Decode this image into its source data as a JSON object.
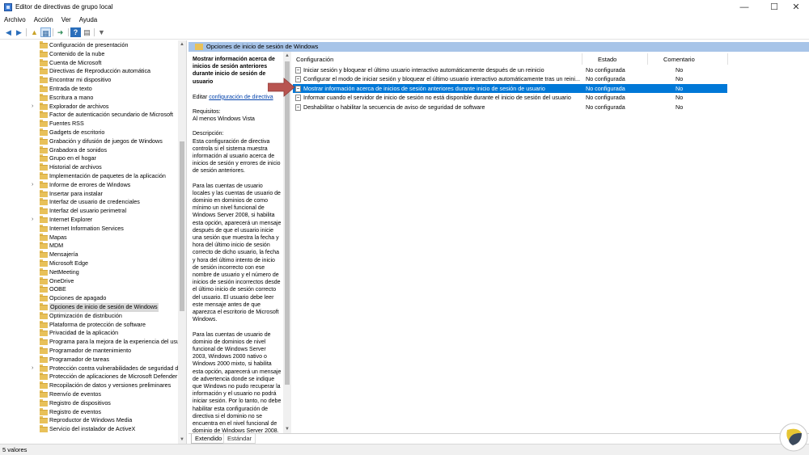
{
  "window": {
    "title": "Editor de directivas de grupo local",
    "minimize": "—",
    "maximize": "☐",
    "close": "✕"
  },
  "menu": [
    "Archivo",
    "Acción",
    "Ver",
    "Ayuda"
  ],
  "toolbar_icons": [
    "back-icon",
    "forward-icon",
    "up-folder-icon",
    "show-tree-icon",
    "export-list-icon",
    "help-icon",
    "properties-icon",
    "filter-icon"
  ],
  "tree": {
    "items": [
      {
        "label": "Configuración de presentación",
        "expandable": false
      },
      {
        "label": "Contenido de la nube",
        "expandable": false
      },
      {
        "label": "Cuenta de Microsoft",
        "expandable": false
      },
      {
        "label": "Directivas de Reproducción automática",
        "expandable": false
      },
      {
        "label": "Encontrar mi dispositivo",
        "expandable": false
      },
      {
        "label": "Entrada de texto",
        "expandable": false
      },
      {
        "label": "Escritura a mano",
        "expandable": false
      },
      {
        "label": "Explorador de archivos",
        "expandable": true
      },
      {
        "label": "Factor de autenticación secundario de Microsoft",
        "expandable": false
      },
      {
        "label": "Fuentes RSS",
        "expandable": false
      },
      {
        "label": "Gadgets de escritorio",
        "expandable": false
      },
      {
        "label": "Grabación y difusión de juegos de Windows",
        "expandable": false
      },
      {
        "label": "Grabadora de sonidos",
        "expandable": false
      },
      {
        "label": "Grupo en el hogar",
        "expandable": false
      },
      {
        "label": "Historial de archivos",
        "expandable": false
      },
      {
        "label": "Implementación de paquetes de la aplicación",
        "expandable": false
      },
      {
        "label": "Informe de errores de Windows",
        "expandable": true
      },
      {
        "label": "Insertar para instalar",
        "expandable": false
      },
      {
        "label": "Interfaz de usuario de credenciales",
        "expandable": false
      },
      {
        "label": "Interfaz del usuario perimetral",
        "expandable": false
      },
      {
        "label": "Internet Explorer",
        "expandable": true
      },
      {
        "label": "Internet Information Services",
        "expandable": false
      },
      {
        "label": "Mapas",
        "expandable": false
      },
      {
        "label": "MDM",
        "expandable": false
      },
      {
        "label": "Mensajería",
        "expandable": false
      },
      {
        "label": "Microsoft Edge",
        "expandable": false
      },
      {
        "label": "NetMeeting",
        "expandable": false
      },
      {
        "label": "OneDrive",
        "expandable": false
      },
      {
        "label": "OOBE",
        "expandable": false
      },
      {
        "label": "Opciones de apagado",
        "expandable": false
      },
      {
        "label": "Opciones de inicio de sesión de Windows",
        "expandable": false,
        "selected": true
      },
      {
        "label": "Optimización de distribución",
        "expandable": false
      },
      {
        "label": "Plataforma de protección de software",
        "expandable": false
      },
      {
        "label": "Privacidad de la aplicación",
        "expandable": false
      },
      {
        "label": "Programa para la mejora de la experiencia del usu",
        "expandable": false
      },
      {
        "label": "Programador de mantenimiento",
        "expandable": false
      },
      {
        "label": "Programador de tareas",
        "expandable": false
      },
      {
        "label": "Protección contra vulnerabilidades de seguridad d",
        "expandable": true
      },
      {
        "label": "Protección de aplicaciones de Microsoft Defender",
        "expandable": false
      },
      {
        "label": "Recopilación de datos y versiones preliminares",
        "expandable": false
      },
      {
        "label": "Reenvío de eventos",
        "expandable": false
      },
      {
        "label": "Registro de dispositivos",
        "expandable": false
      },
      {
        "label": "Registro de eventos",
        "expandable": false
      },
      {
        "label": "Reproductor de Windows Media",
        "expandable": false
      },
      {
        "label": "Servicio del instalador de ActiveX",
        "expandable": false
      }
    ]
  },
  "header": {
    "title": "Opciones de inicio de sesión de Windows"
  },
  "description": {
    "title": "Mostrar información acerca de inicios de sesión anteriores durante inicio de sesión de usuario",
    "edit_prefix": "Editar ",
    "edit_link": "configuración de directiva",
    "requirements_label": "Requisitos:",
    "requirements_value": "Al menos Windows Vista",
    "description_label": "Descripción:",
    "para1": "Esta configuración de directiva controla si el sistema muestra información al usuario acerca de inicios de sesión y errores de inicio de sesión anteriores.",
    "para2": "Para las cuentas de usuario locales y las cuentas de usuario de dominio en dominios de como mínimo un nivel funcional de Windows Server 2008, si habilita esta opción, aparecerá un mensaje después de que el usuario inicie una sesión que muestra la fecha y hora del último inicio de sesión correcto de dicho usuario, la fecha y hora del último intento de inicio de sesión incorrecto con ese nombre de usuario y el número de inicios de sesión incorrectos desde el último inicio de sesión correcto del usuario. El usuario debe leer este mensaje antes de que aparezca el escritorio de Microsoft Windows.",
    "para3": "Para las cuentas de usuario de dominio de dominios de nivel funcional de Windows Server 2003, Windows 2000 nativo o Windows 2000 mixto, si habilita esta opción, aparecerá un mensaje de advertencia donde se indique que Windows no pudo recuperar la información y el usuario no podrá iniciar sesión. Por lo tanto, no debe habilitar esta configuración de directiva si el dominio no se encuentra en el nivel funcional de dominio de Windows Server 2008."
  },
  "list": {
    "columns": {
      "config": "Configuración",
      "estado": "Estado",
      "comentario": "Comentario"
    },
    "rows": [
      {
        "config": "Iniciar sesión y bloquear el último usuario interactivo automáticamente después de un reinicio",
        "estado": "No configurada",
        "comentario": "No"
      },
      {
        "config": "Configurar el modo de iniciar sesión y bloquear el último usuario interactivo automáticamente tras un reini...",
        "estado": "No configurada",
        "comentario": "No"
      },
      {
        "config": "Mostrar información acerca de inicios de sesión anteriores durante inicio de sesión de usuario",
        "estado": "No configurada",
        "comentario": "No",
        "selected": true
      },
      {
        "config": "Informar cuando el servidor de inicio de sesión no está disponible durante el inicio de sesión del usuario",
        "estado": "No configurada",
        "comentario": "No"
      },
      {
        "config": "Deshabilitar o habilitar la secuencia de aviso de seguridad de software",
        "estado": "No configurada",
        "comentario": "No"
      }
    ]
  },
  "tabs": [
    "Extendido",
    "Estándar"
  ],
  "status": "5 valores",
  "colors": {
    "selection": "#0078d7",
    "header_band": "#a7c4e8",
    "arrow": "#b85450"
  }
}
